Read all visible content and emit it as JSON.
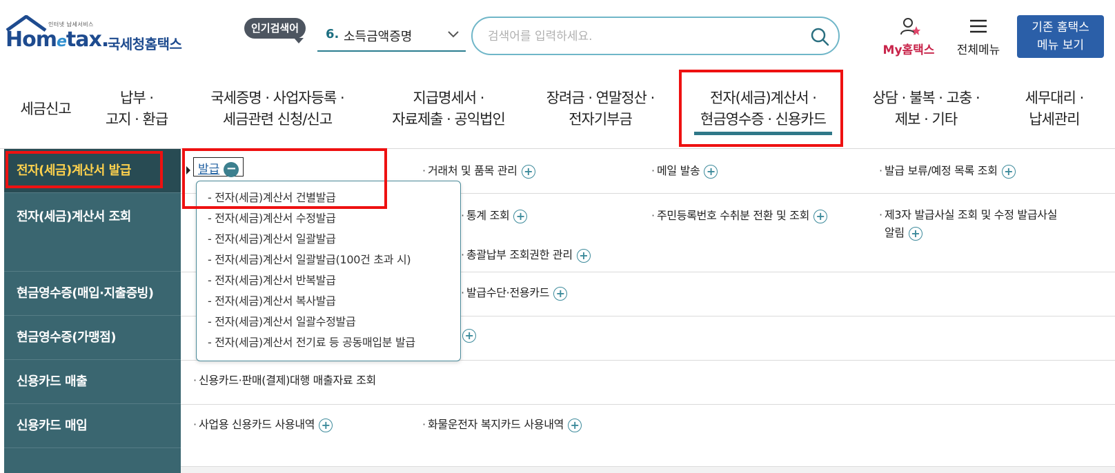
{
  "header": {
    "logo_small": "인터넷 납세서비스",
    "logo_en_1": "Hom",
    "logo_en_e": "e",
    "logo_en_2": "tax.",
    "logo_ko": "국세청홈택스",
    "popular_badge": "인기검색어",
    "popular_num": "6.",
    "popular_term": "소득금액증명",
    "search_placeholder": "검색어를 입력하세요.",
    "my_label": "My홈택스",
    "menu_label": "전체메뉴",
    "classic_label_1": "기존 홈택스",
    "classic_label_2": "메뉴 보기"
  },
  "gnb": [
    {
      "label": "세금신고"
    },
    {
      "label": "납부 · \n고지 · 환급"
    },
    {
      "label": "국세증명 · 사업자등록 · \n세금관련 신청/신고"
    },
    {
      "label": "지급명세서 · \n자료제출 · 공익법인"
    },
    {
      "label": "장려금 · 연말정산 · \n전자기부금"
    },
    {
      "label": "전자(세금)계산서 · \n현금영수증 · 신용카드"
    },
    {
      "label": "상담 · 불복 · 고충 · \n제보 · 기타"
    },
    {
      "label": "세무대리 · \n납세관리"
    }
  ],
  "sidebar": [
    {
      "label": "전자(세금)계산서 발급"
    },
    {
      "label": "전자(세금)계산서 조회"
    },
    {
      "label": "현금영수증(매입·지출증빙)"
    },
    {
      "label": "현금영수증(가맹점)"
    },
    {
      "label": "신용카드 매출"
    },
    {
      "label": "신용카드 매입"
    }
  ],
  "content": {
    "issue_label": "발급",
    "row1": [
      "거래처 및 품목 관리",
      "메일 발송",
      "발급 보류/예정 목록 조회"
    ],
    "row2": [
      "통계 조회",
      "주민등록번호 수취분 전환 및 조회",
      "제3자 발급사실 조회 및 수정 발급사실",
      "알림"
    ],
    "row2b": "총괄납부 조회권한 관리",
    "row3": "발급수단·전용카드",
    "row5": "신용카드·판매(결제)대행 매출자료 조회",
    "row6": [
      "사업용 신용카드 사용내역",
      "화물운전자 복지카드 사용내역"
    ]
  },
  "dropdown": [
    "전자(세금)계산서 건별발급",
    "전자(세금)계산서 수정발급",
    "전자(세금)계산서 일괄발급",
    "전자(세금)계산서 일괄발급(100건 초과 시)",
    "전자(세금)계산서 반복발급",
    "전자(세금)계산서 복사발급",
    "전자(세금)계산서 일괄수정발급",
    "전자(세금)계산서 전기료 등 공동매입분 발급"
  ],
  "colors": {
    "accent": "#2f7888",
    "sidebar": "#3a6670",
    "highlight": "#ee1111",
    "active_text": "#ffd24d"
  }
}
